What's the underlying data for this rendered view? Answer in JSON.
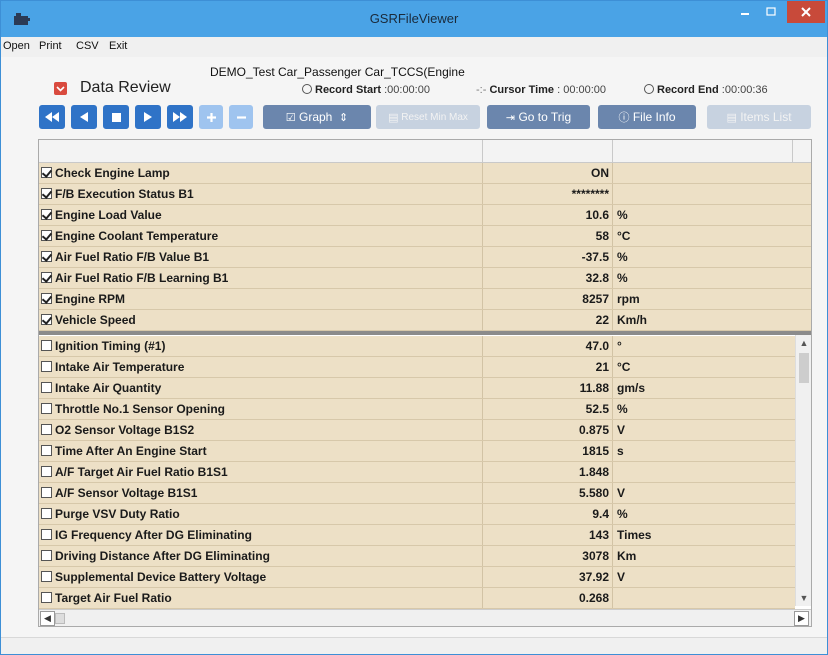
{
  "window": {
    "title": "GSRFileViewer"
  },
  "menu": {
    "items": [
      "Open",
      "Print",
      "CSV",
      "Exit"
    ]
  },
  "header": {
    "section_title": "Data Review",
    "file_title": "DEMO_Test Car_Passenger Car_TCCS(Engine",
    "record_start_label": "Record Start",
    "record_start_value": ":00:00:00",
    "cursor_time_label": "Cursor Time",
    "cursor_time_value": ": 00:00:00",
    "record_end_label": "Record End",
    "record_end_value": ":00:00:36"
  },
  "toolbar": {
    "graph_label": "Graph",
    "reset_label": "Reset Min Max",
    "goto_label": "Go to Trig",
    "fileinfo_label": "File Info",
    "items_label": "Items List"
  },
  "colors": {
    "accent": "#2f73c7",
    "row_bg": "#ede0c6",
    "titlebar": "#4aa3e6",
    "close": "#c84a3a"
  },
  "pinned_rows": [
    {
      "name": "Check Engine Lamp",
      "value": "ON",
      "unit": ""
    },
    {
      "name": "F/B Execution Status B1",
      "value": "********",
      "unit": ""
    },
    {
      "name": "Engine Load Value",
      "value": "10.6",
      "unit": "%"
    },
    {
      "name": "Engine Coolant Temperature",
      "value": "58",
      "unit": "°C"
    },
    {
      "name": "Air Fuel Ratio F/B Value B1",
      "value": "-37.5",
      "unit": "%"
    },
    {
      "name": "Air Fuel Ratio F/B Learning B1",
      "value": "32.8",
      "unit": "%"
    },
    {
      "name": "Engine RPM",
      "value": "8257",
      "unit": "rpm"
    },
    {
      "name": "Vehicle Speed",
      "value": "22",
      "unit": "Km/h"
    }
  ],
  "scroll_rows": [
    {
      "name": "Ignition Timing (#1)",
      "value": "47.0",
      "unit": "°"
    },
    {
      "name": "Intake Air Temperature",
      "value": "21",
      "unit": "°C"
    },
    {
      "name": "Intake Air Quantity",
      "value": "11.88",
      "unit": "gm/s"
    },
    {
      "name": "Throttle No.1 Sensor Opening",
      "value": "52.5",
      "unit": "%"
    },
    {
      "name": "O2 Sensor Voltage B1S2",
      "value": "0.875",
      "unit": "V"
    },
    {
      "name": "Time After An Engine Start",
      "value": "1815",
      "unit": "s"
    },
    {
      "name": "A/F Target Air Fuel Ratio B1S1",
      "value": "1.848",
      "unit": ""
    },
    {
      "name": "A/F Sensor Voltage B1S1",
      "value": "5.580",
      "unit": "V"
    },
    {
      "name": "Purge VSV Duty Ratio",
      "value": "9.4",
      "unit": "%"
    },
    {
      "name": "IG Frequency After DG Eliminating",
      "value": "143",
      "unit": "Times"
    },
    {
      "name": "Driving Distance After DG Eliminating",
      "value": "3078",
      "unit": "Km"
    },
    {
      "name": "Supplemental Device Battery Voltage",
      "value": "37.92",
      "unit": "V"
    },
    {
      "name": "Target Air Fuel Ratio",
      "value": "0.268",
      "unit": ""
    }
  ]
}
